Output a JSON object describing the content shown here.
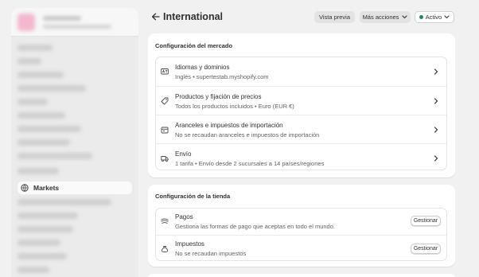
{
  "header": {
    "title": "International",
    "preview_label": "Vista previa",
    "more_actions_label": "Más acciones",
    "status_label": "Activo",
    "status_color": "#29845a"
  },
  "sidebar": {
    "active_item": {
      "label": "Markets",
      "icon": "globe-icon"
    }
  },
  "market_config": {
    "title": "Configuración del mercado",
    "rows": [
      {
        "title": "Idiomas y dominios",
        "subtitle": "Inglés • supertestab.myshopify.com",
        "icon": "translate-icon"
      },
      {
        "title": "Productos y fijación de precios",
        "subtitle": "Todos los productos incluidos • Euro (EUR €)",
        "icon": "price-tag-icon"
      },
      {
        "title": "Aranceles e impuestos de importación",
        "subtitle": "No se recaudan aranceles e impuestos de importación",
        "icon": "customs-icon"
      },
      {
        "title": "Envío",
        "subtitle": "1 tarifa • Envío desde 2 sucursales a 14 países/regiones",
        "icon": "truck-icon"
      }
    ]
  },
  "store_config": {
    "title": "Configuración de la tienda",
    "rows": [
      {
        "title": "Pagos",
        "subtitle": "Gestiona las formas de pago que aceptas en todo el mundo.",
        "button": "Gestionar",
        "icon": "cash-icon"
      },
      {
        "title": "Impuestos",
        "subtitle": "No se recaudan impuestos",
        "button": "Gestionar",
        "icon": "tax-bag-icon"
      }
    ]
  }
}
